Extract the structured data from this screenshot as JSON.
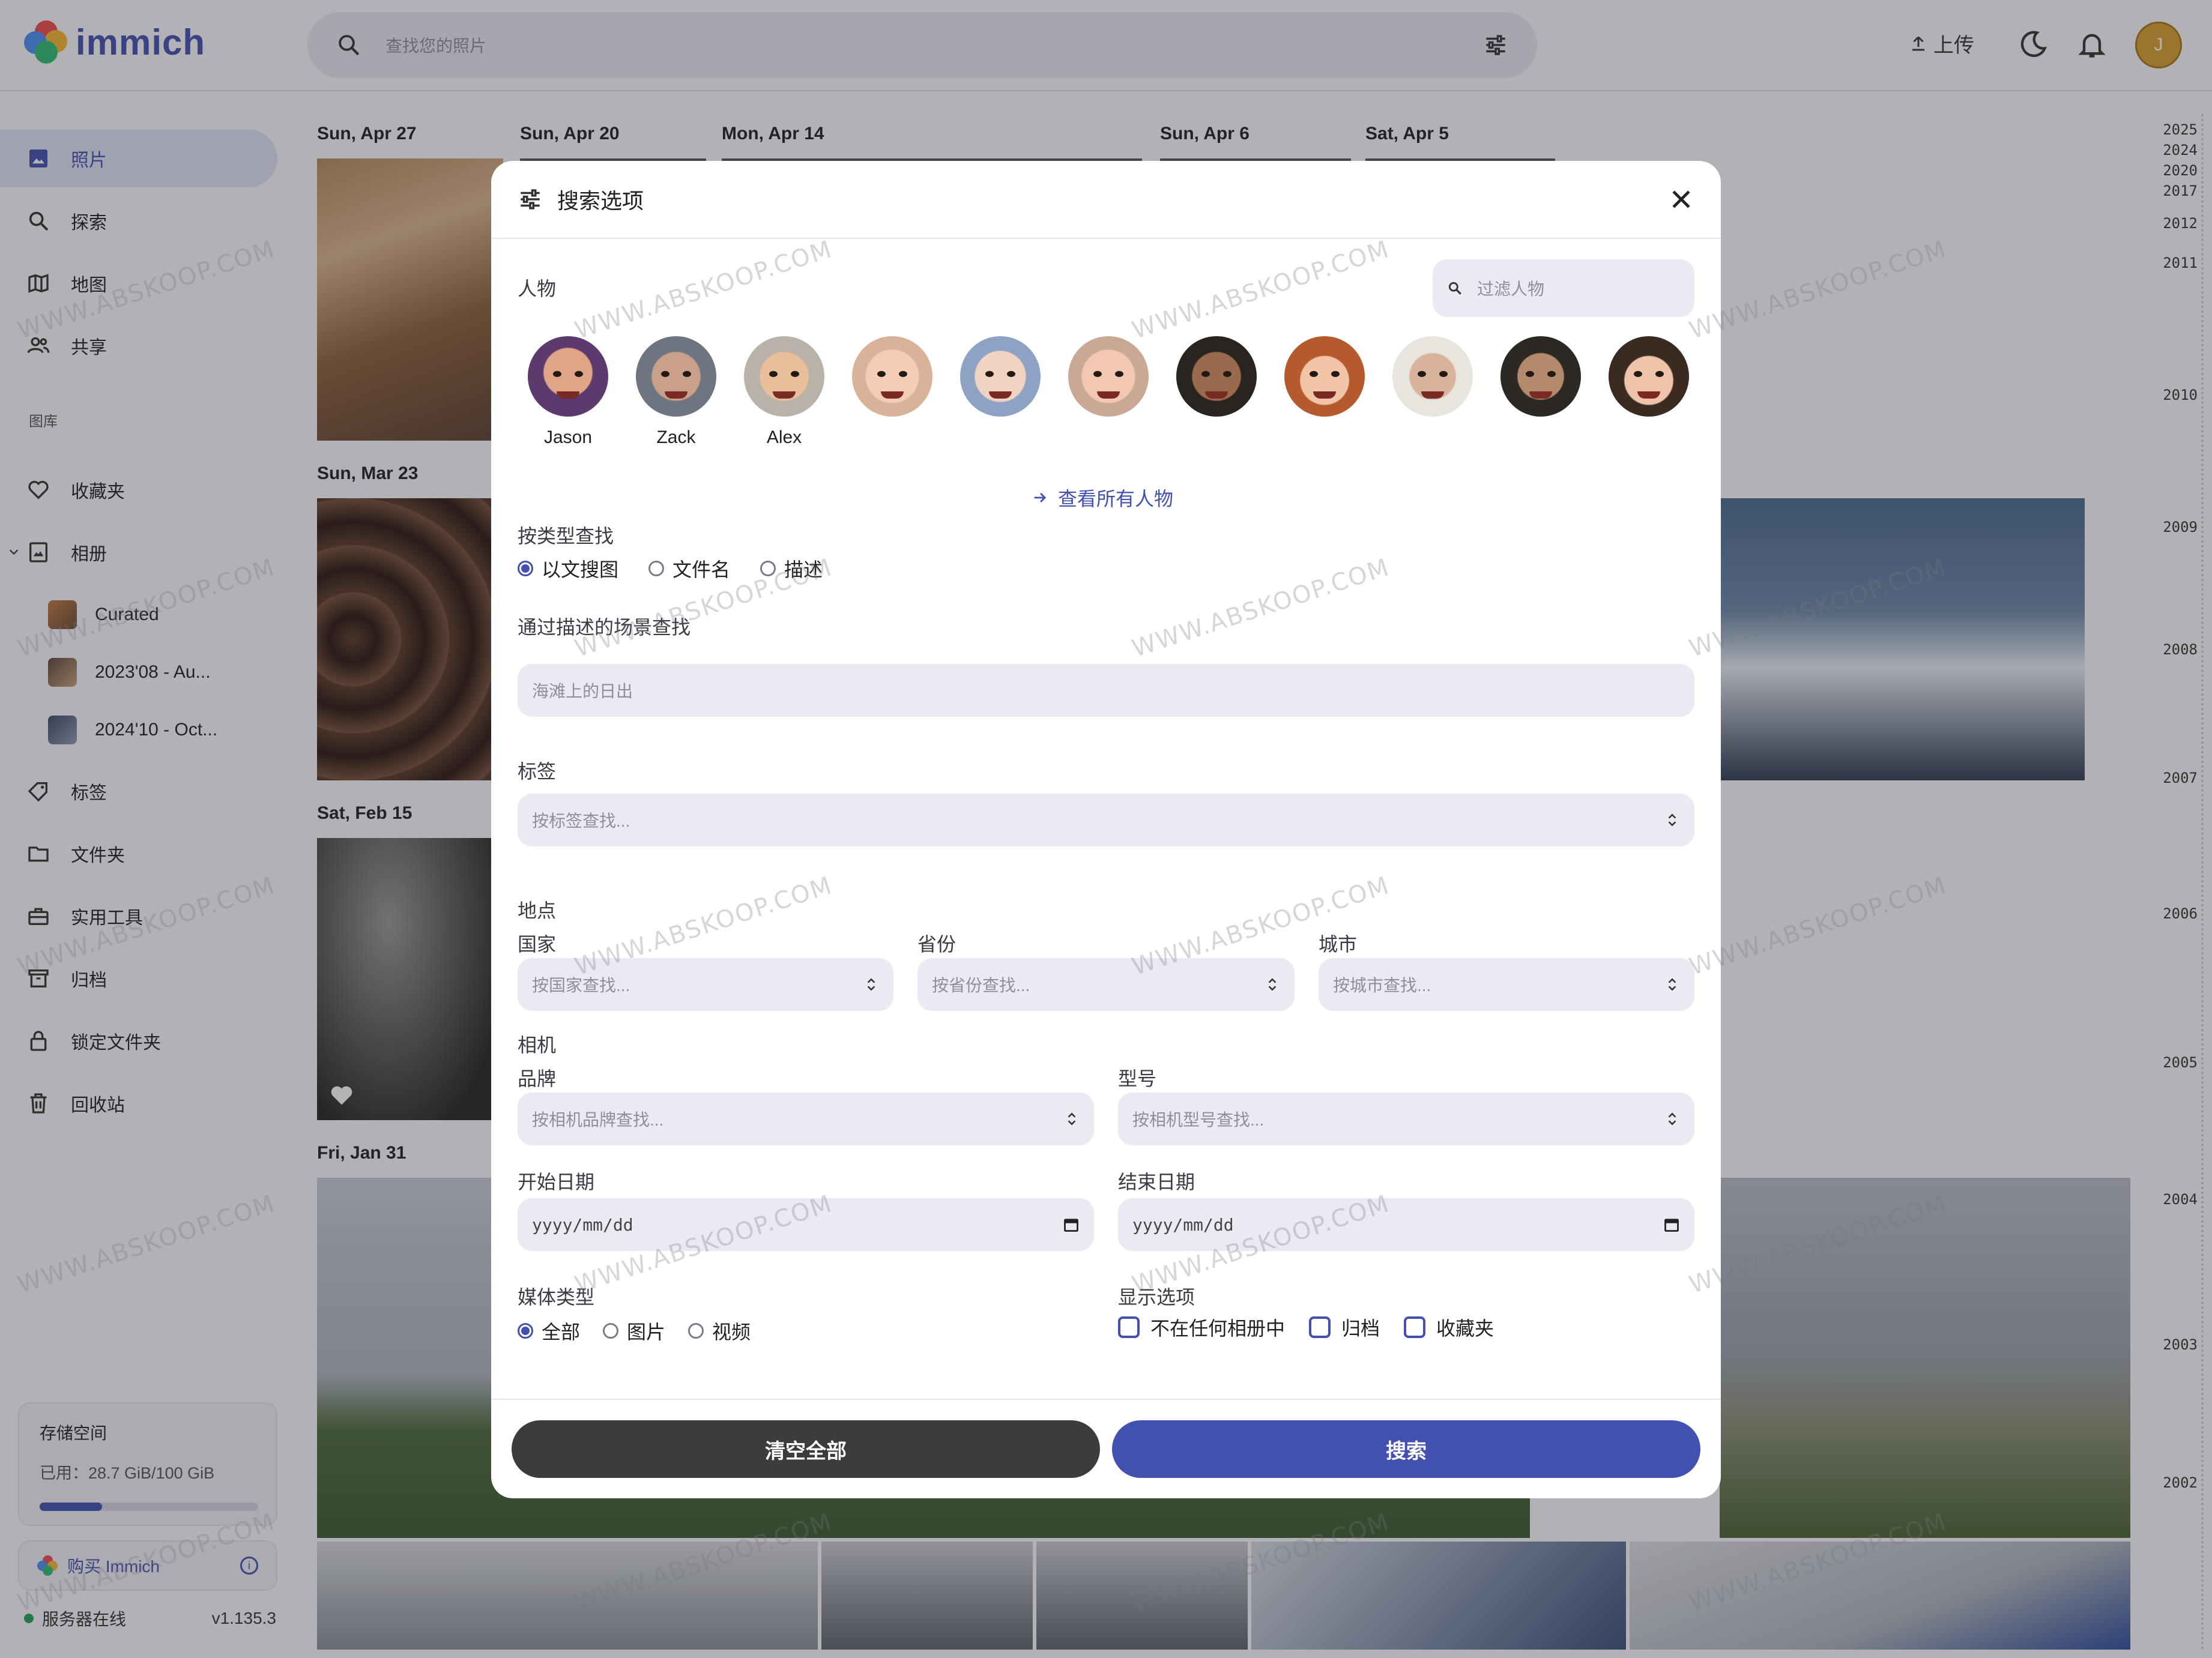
{
  "app": {
    "name": "immich"
  },
  "header": {
    "search_placeholder": "查找您的照片",
    "upload_label": "上传",
    "avatar_initial": "J"
  },
  "sidebar": {
    "items": [
      {
        "label": "照片",
        "icon": "photos-icon"
      },
      {
        "label": "探索",
        "icon": "search-icon"
      },
      {
        "label": "地图",
        "icon": "map-icon"
      },
      {
        "label": "共享",
        "icon": "people-share-icon"
      }
    ],
    "library_label": "图库",
    "library_items": [
      {
        "label": "收藏夹",
        "icon": "heart-icon"
      },
      {
        "label": "相册",
        "icon": "album-icon"
      }
    ],
    "albums": [
      {
        "label": "Curated"
      },
      {
        "label": "2023'08 - Au..."
      },
      {
        "label": "2024'10 - Oct..."
      }
    ],
    "more_items": [
      {
        "label": "标签",
        "icon": "tag-icon"
      },
      {
        "label": "文件夹",
        "icon": "folder-icon"
      },
      {
        "label": "实用工具",
        "icon": "toolbox-icon"
      },
      {
        "label": "归档",
        "icon": "archive-icon"
      },
      {
        "label": "锁定文件夹",
        "icon": "lock-icon"
      },
      {
        "label": "回收站",
        "icon": "trash-icon"
      }
    ],
    "storage": {
      "title": "存储空间",
      "used_text": "已用：28.7 GiB/100 GiB",
      "used_fraction": 0.287
    },
    "buy_label": "购买 Immich",
    "server_status": "服务器在线",
    "version": "v1.135.3"
  },
  "timeline": {
    "date_labels": [
      "Sun, Apr 27",
      "Sun, Apr 20",
      "Mon, Apr 14",
      "Sun, Apr 6",
      "Sat, Apr 5",
      "Sun, Mar 23",
      "Sat, Feb 15",
      "Fri, Jan 31"
    ],
    "years": [
      "2025",
      "2024",
      "2020",
      "2017",
      "2012",
      "2011",
      "2010",
      "2009",
      "2008",
      "2007",
      "2006",
      "2005",
      "2004",
      "2003",
      "2002"
    ]
  },
  "modal": {
    "title": "搜索选项",
    "people_label": "人物",
    "people_filter_placeholder": "过滤人物",
    "people": [
      {
        "name": "Jason"
      },
      {
        "name": "Zack"
      },
      {
        "name": "Alex"
      },
      {
        "name": ""
      },
      {
        "name": ""
      },
      {
        "name": ""
      },
      {
        "name": ""
      },
      {
        "name": ""
      },
      {
        "name": ""
      },
      {
        "name": ""
      },
      {
        "name": ""
      }
    ],
    "view_all_people": "查看所有人物",
    "search_type_label": "按类型查找",
    "search_types": [
      {
        "label": "以文搜图",
        "selected": true
      },
      {
        "label": "文件名",
        "selected": false
      },
      {
        "label": "描述",
        "selected": false
      }
    ],
    "context_label": "通过描述的场景查找",
    "context_placeholder": "海滩上的日出",
    "tags_label": "标签",
    "tags_placeholder": "按标签查找...",
    "location_label": "地点",
    "country_label": "国家",
    "country_placeholder": "按国家查找...",
    "state_label": "省份",
    "state_placeholder": "按省份查找...",
    "city_label": "城市",
    "city_placeholder": "按城市查找...",
    "camera_label": "相机",
    "make_label": "品牌",
    "make_placeholder": "按相机品牌查找...",
    "model_label": "型号",
    "model_placeholder": "按相机型号查找...",
    "start_date_label": "开始日期",
    "end_date_label": "结束日期",
    "date_placeholder": "yyyy/mm/dd",
    "media_type_label": "媒体类型",
    "media_types": [
      {
        "label": "全部",
        "selected": true
      },
      {
        "label": "图片",
        "selected": false
      },
      {
        "label": "视频",
        "selected": false
      }
    ],
    "display_options_label": "显示选项",
    "display_options": [
      {
        "label": "不在任何相册中",
        "checked": false
      },
      {
        "label": "归档",
        "checked": false
      },
      {
        "label": "收藏夹",
        "checked": false
      }
    ],
    "clear_all_label": "清空全部",
    "search_label": "搜索"
  },
  "colors": {
    "accent": "#4250af",
    "dark_button": "#3c3c3e",
    "overlay": "rgba(40,40,50,0.35)"
  },
  "watermark": "WWW.ABSKOOP.COM"
}
